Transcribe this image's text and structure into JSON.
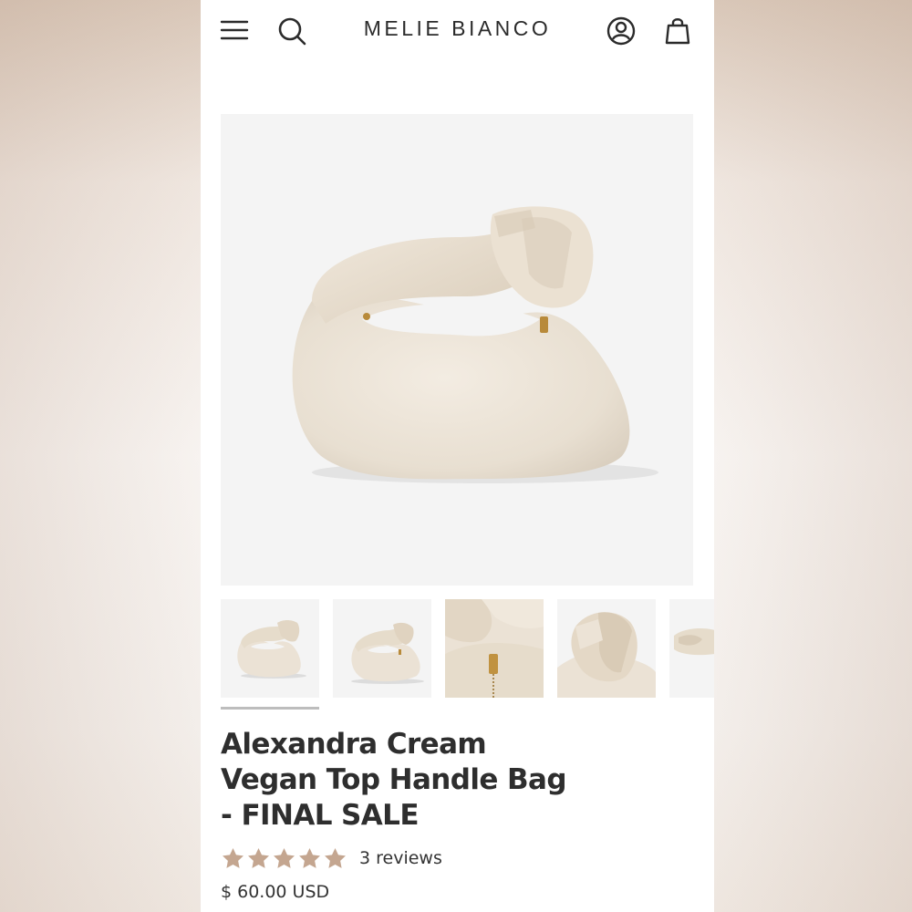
{
  "header": {
    "brand": "MELIE BIANCO",
    "icons": [
      "menu-icon",
      "search-icon",
      "account-icon",
      "bag-icon"
    ]
  },
  "gallery": {
    "thumbnail_count": 5,
    "selected_index": 0
  },
  "product": {
    "title": "Alexandra Cream Vegan Top Handle Bag - FINAL SALE",
    "rating_stars": 5,
    "reviews_text": "3 reviews",
    "price": "$ 60.00 USD"
  },
  "colors": {
    "text": "#2e2e2e",
    "star": "#c4a690",
    "bag": "#ece3d6",
    "image_bg": "#f4f4f4"
  }
}
